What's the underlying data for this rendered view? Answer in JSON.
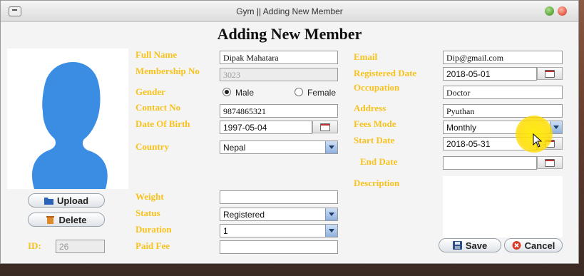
{
  "window": {
    "title": "Gym || Adding New Member"
  },
  "form": {
    "heading": "Adding New Member",
    "photo": {
      "upload_label": "Upload",
      "delete_label": "Delete"
    },
    "id": {
      "label": "ID:",
      "value": "26"
    },
    "left": {
      "full_name": {
        "label": "Full Name",
        "value": "Dipak Mahatara"
      },
      "membership_no": {
        "label": "Membership No",
        "value": "3023"
      },
      "gender": {
        "label": "Gender",
        "options": [
          "Male",
          "Female"
        ],
        "selected": "Male"
      },
      "contact_no": {
        "label": "Contact No",
        "value": "9874865321"
      },
      "dob": {
        "label": "Date Of Birth",
        "value": "1997-05-04"
      },
      "country": {
        "label": "Country",
        "value": "Nepal"
      },
      "weight": {
        "label": "Weight",
        "value": ""
      },
      "status": {
        "label": "Status",
        "value": "Registered"
      },
      "duration": {
        "label": "Duration",
        "value": "1"
      },
      "paid_fee": {
        "label": "Paid Fee",
        "value": ""
      }
    },
    "right": {
      "email": {
        "label": "Email",
        "value": "Dip@gmail.com"
      },
      "registered_date": {
        "label": "Registered Date",
        "value": "2018-05-01"
      },
      "occupation": {
        "label": "Occupation",
        "value": "Doctor"
      },
      "address": {
        "label": "Address",
        "value": "Pyuthan"
      },
      "fees_mode": {
        "label": "Fees Mode",
        "value": "Monthly"
      },
      "start_date": {
        "label": "Start Date",
        "value": "2018-05-31"
      },
      "end_date": {
        "label": "End Date",
        "value": ""
      },
      "description": {
        "label": "Description",
        "value": ""
      }
    },
    "actions": {
      "save_label": "Save",
      "cancel_label": "Cancel"
    }
  },
  "colors": {
    "label": "#f7c21b",
    "silhouette": "#3b8de3"
  }
}
